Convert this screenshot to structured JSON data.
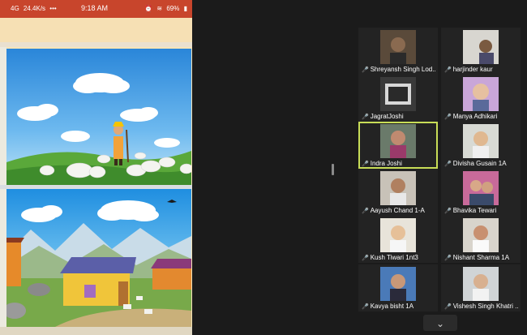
{
  "status_bar": {
    "signal": "4G",
    "speed": "24.4K/s",
    "more": "•••",
    "time": "9:18 AM",
    "battery": "69%"
  },
  "gallery": {
    "tiles": [
      {
        "name": "Shreyansh Singh Lod...",
        "muted": true
      },
      {
        "name": "harjinder kaur",
        "muted": true
      },
      {
        "name": "JagratJoshi",
        "muted": true
      },
      {
        "name": "Manya Adhikari",
        "muted": true
      },
      {
        "name": "Indra Joshi",
        "muted": true,
        "active": true
      },
      {
        "name": "Divisha Gusain 1A",
        "muted": true
      },
      {
        "name": "Aayush Chand 1-A",
        "muted": true
      },
      {
        "name": "Bhavika Tewari",
        "muted": true
      },
      {
        "name": "Kush Tiwari 1nt3",
        "muted": true
      },
      {
        "name": "Nishant Sharma 1A",
        "muted": true
      },
      {
        "name": "Kavya bisht 1A",
        "muted": true
      },
      {
        "name": "Vishesh Singh Khatri ...",
        "muted": true
      }
    ],
    "mic_icon": "mic-muted-icon",
    "scroll_icon": "chevron-down-icon"
  },
  "colors": {
    "status_bar": "#c8452c",
    "active_speaker": "#c8dd57",
    "background": "#1b1b1b"
  }
}
